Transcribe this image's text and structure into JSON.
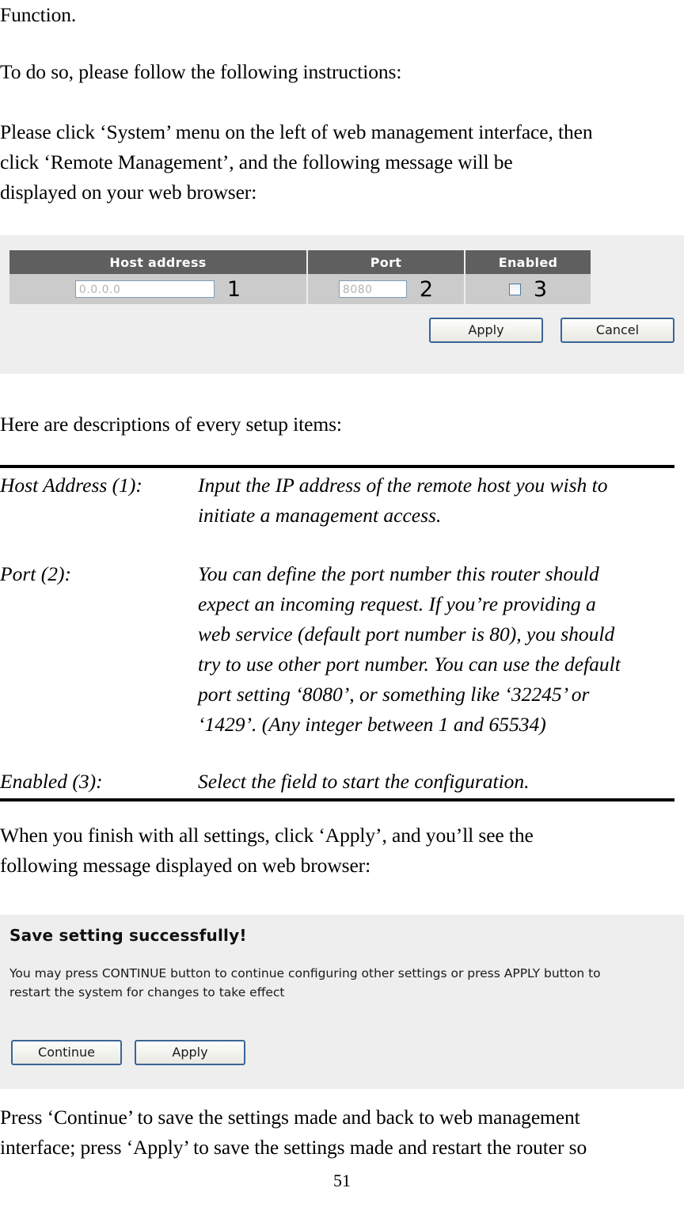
{
  "document": {
    "page_number": "51",
    "paragraphs": {
      "p1": "Function.",
      "p2": "To do so, please follow the following instructions:",
      "p3_line1": "Please click ‘System’ menu on the left of web management interface, then",
      "p3_line2": "click ‘Remote Management’, and the following message will be",
      "p3_line3": "displayed on your web browser:",
      "p4": "Here are descriptions of every setup items:",
      "p5_line1": "When you finish with all settings, click ‘Apply’, and you’ll see the",
      "p5_line2": "following message displayed on web browser:",
      "p6_line1": "Press ‘Continue’ to save the settings made and back to web management",
      "p6_line2": "interface; press ‘Apply’ to save the settings made and restart the router so"
    }
  },
  "remote_management_screenshot": {
    "table": {
      "headers": [
        "Host address",
        "Port",
        "Enabled"
      ],
      "row": {
        "host_address_value": "0.0.0.0",
        "host_address_marker": "1",
        "port_value": "8080",
        "port_marker": "2",
        "enabled_checked": false,
        "enabled_marker": "3"
      }
    },
    "buttons": {
      "apply": "Apply",
      "cancel": "Cancel"
    },
    "colors": {
      "panel_background": "#eeeeee",
      "header_background": "#5f5f5f",
      "row_background": "#cbcbcb",
      "input_border": "#7f9db9",
      "button_border": "#3a6597"
    }
  },
  "definitions": [
    {
      "term": "Host Address (1):",
      "description_lines": [
        "Input the IP address of the remote host you wish to",
        "initiate a management access."
      ]
    },
    {
      "term": "Port (2):",
      "description_lines": [
        "You can define the port number this router should",
        "expect an incoming request. If you’re providing a",
        "web service (default port number is 80), you should",
        "try to use other port number. You can use the default",
        "port setting ‘8080’, or something like ‘32245’ or",
        "‘1429’. (Any integer between 1 and 65534)"
      ]
    },
    {
      "term": "Enabled (3):",
      "description_lines": [
        "Select the field to start the configuration."
      ]
    }
  ],
  "save_setting_screenshot": {
    "title": "Save setting successfully!",
    "body_line1": "You may press CONTINUE button to continue configuring other settings or press APPLY button to",
    "body_line2": "restart the system for changes to take effect",
    "buttons": {
      "continue": "Continue",
      "apply": "Apply"
    }
  }
}
